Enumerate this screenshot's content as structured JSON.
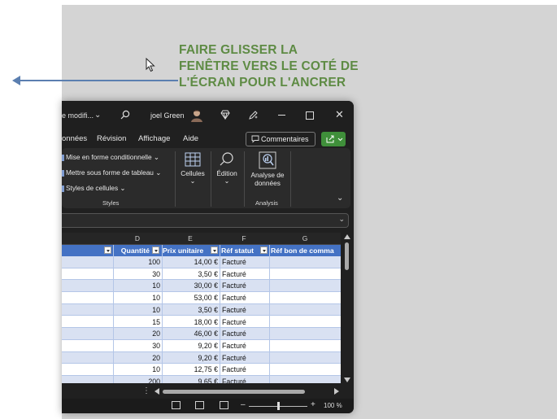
{
  "annotation": {
    "lines": [
      "FAIRE GLISSER LA",
      "FENÊTRE VERS LE COTÉ DE",
      "L'ÉCRAN POUR L'ANCRER"
    ]
  },
  "titlebar": {
    "file_title": "e modifi...",
    "user_name": "joel Green"
  },
  "menu": {
    "items": [
      "onnées",
      "Révision",
      "Affichage",
      "Aide"
    ],
    "comments_label": "Commentaires"
  },
  "ribbon": {
    "styles": {
      "conditional": "Mise en forme conditionnelle",
      "table": "Mettre sous forme de tableau",
      "cell_styles": "Styles de cellules",
      "group_label": "Styles"
    },
    "cells_label": "Cellules",
    "edit_label": "Édition",
    "analysis": {
      "line1": "Analyse de",
      "line2": "données",
      "group_label": "Analysis"
    }
  },
  "columns": [
    "D",
    "E",
    "F",
    "G"
  ],
  "table": {
    "headers": [
      "Quantité",
      "Prix unitaire",
      "Réf statut",
      "Réf bon de comma"
    ],
    "rows": [
      {
        "qty": "100",
        "price": "14,00 €",
        "status": "Facturé"
      },
      {
        "qty": "30",
        "price": "3,50 €",
        "status": "Facturé"
      },
      {
        "qty": "10",
        "price": "30,00 €",
        "status": "Facturé"
      },
      {
        "qty": "10",
        "price": "53,00 €",
        "status": "Facturé"
      },
      {
        "qty": "10",
        "price": "3,50 €",
        "status": "Facturé"
      },
      {
        "qty": "15",
        "price": "18,00 €",
        "status": "Facturé"
      },
      {
        "qty": "20",
        "price": "46,00 €",
        "status": "Facturé"
      },
      {
        "qty": "30",
        "price": "9,20 €",
        "status": "Facturé"
      },
      {
        "qty": "20",
        "price": "9,20 €",
        "status": "Facturé"
      },
      {
        "qty": "10",
        "price": "12,75 €",
        "status": "Facturé"
      },
      {
        "qty": "200",
        "price": "9,65 €",
        "status": "Facturé"
      }
    ]
  },
  "status": {
    "zoom": "100 %"
  },
  "colors": {
    "annotation": "#5e8b44",
    "arrow": "#5b7fb0",
    "table_header": "#4472c4",
    "row_alt": "#d9e1f2",
    "share_button": "#3f8f3a"
  }
}
